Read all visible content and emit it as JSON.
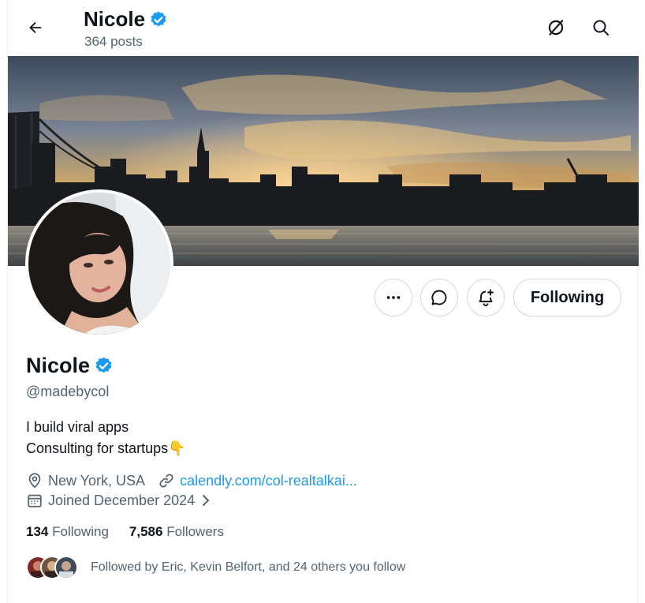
{
  "header": {
    "name": "Nicole",
    "posts": "364 posts"
  },
  "profile": {
    "name": "Nicole",
    "handle": "@madebycol",
    "bio_line1": "I build viral apps",
    "bio_line2": "Consulting for startups",
    "bio_emoji": "👇",
    "location": "New York, USA",
    "website": "calendly.com/col-realtalkai...",
    "joined": "Joined December 2024",
    "following_count": "134",
    "following_label": "Following",
    "followers_count": "7,586",
    "followers_label": "Followers",
    "followed_by": "Followed by Eric, Kevin Belfort, and 24 others you follow"
  },
  "actions": {
    "follow_label": "Following"
  },
  "icons": [
    "back-arrow-icon",
    "verified-badge-icon",
    "grok-icon",
    "search-icon",
    "more-icon",
    "message-icon",
    "notification-bell-icon",
    "location-pin-icon",
    "link-icon",
    "calendar-icon",
    "chevron-right-icon"
  ],
  "colors": {
    "accent": "#1d9bf0",
    "text": "#0f1419",
    "secondary": "#536471",
    "border": "#cfd9de"
  }
}
